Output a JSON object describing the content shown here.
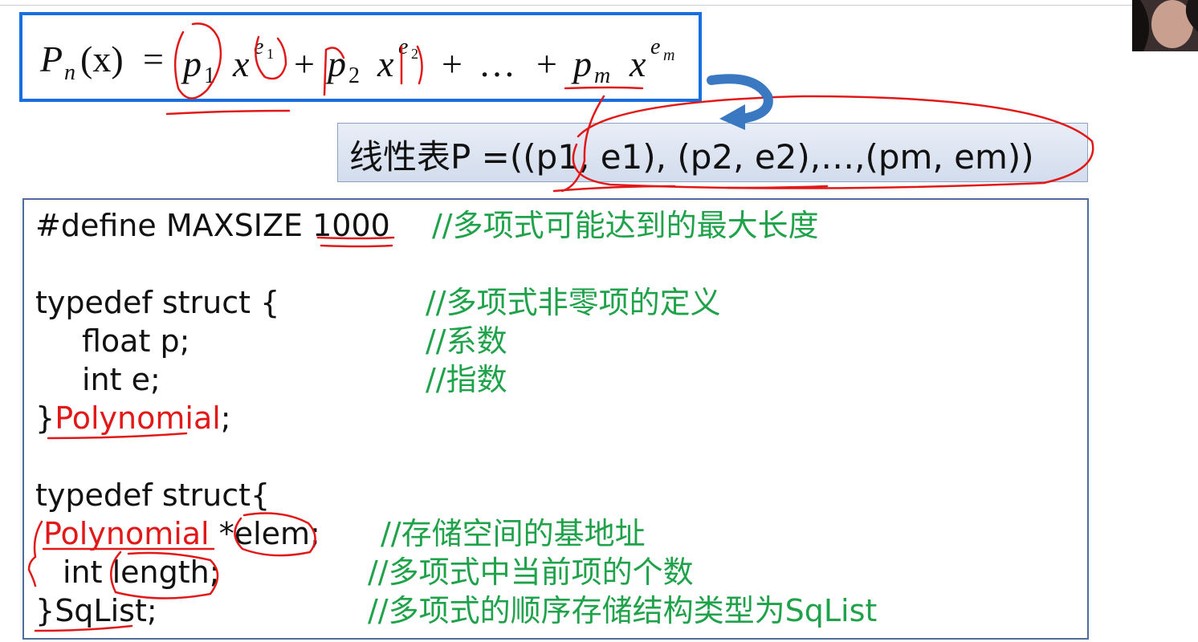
{
  "formula": {
    "P": "P",
    "n": "n",
    "x_paren": "(x)",
    "eq": "=",
    "p": "p",
    "sub1": "1",
    "sub2": "2",
    "subm": "m",
    "x": "x",
    "e": "e",
    "plus": "+",
    "dots": "…"
  },
  "linear_table": "线性表P =((p1, e1), (p2, e2),…,(pm, em))",
  "code": {
    "define_prefix": "#define MAXSIZE ",
    "define_value": "1000",
    "define_comment": "//多项式可能达到的最大长度",
    "struct1_open": "typedef struct   {",
    "struct1_open_comment": "//多项式非零项的定义",
    "field_p": "float p;",
    "field_p_comment": "//系数",
    "field_e": "int    e;",
    "field_e_comment": "//指数",
    "struct1_close_brace": "}",
    "struct1_name": "Polynomial",
    "struct1_semicolon": ";",
    "struct2_open": "typedef struct{",
    "elem_type": "Polynomial",
    "elem_name": " *elem;",
    "elem_comment": "//存储空间的基地址",
    "length_field": "int length;",
    "length_comment": "//多项式中当前项的个数",
    "struct2_close_brace": "}",
    "struct2_name": "SqList;",
    "struct2_comment": "//多项式的顺序存储结构类型为SqList"
  },
  "colors": {
    "formula_border": "#1a6fe0",
    "comment": "#1fa24a",
    "keyword_red": "#e21818",
    "annotation_ink": "#e21818"
  }
}
